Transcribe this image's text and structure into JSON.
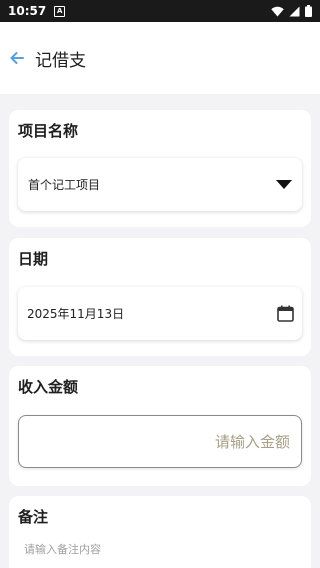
{
  "status_bar": {
    "time": "10:57",
    "notification_icon": "a-box-icon"
  },
  "app_bar": {
    "title": "记借支",
    "back_icon": "arrow-left-icon"
  },
  "project": {
    "label": "项目名称",
    "selected": "首个记工项目"
  },
  "date": {
    "label": "日期",
    "value": "2025年11月13日"
  },
  "income": {
    "label": "收入金额",
    "placeholder": "请输入金额"
  },
  "note": {
    "label": "备注",
    "placeholder": "请输入备注内容"
  },
  "colors": {
    "accent_back": "#5aa0d8",
    "placeholder": "#a79f86"
  }
}
